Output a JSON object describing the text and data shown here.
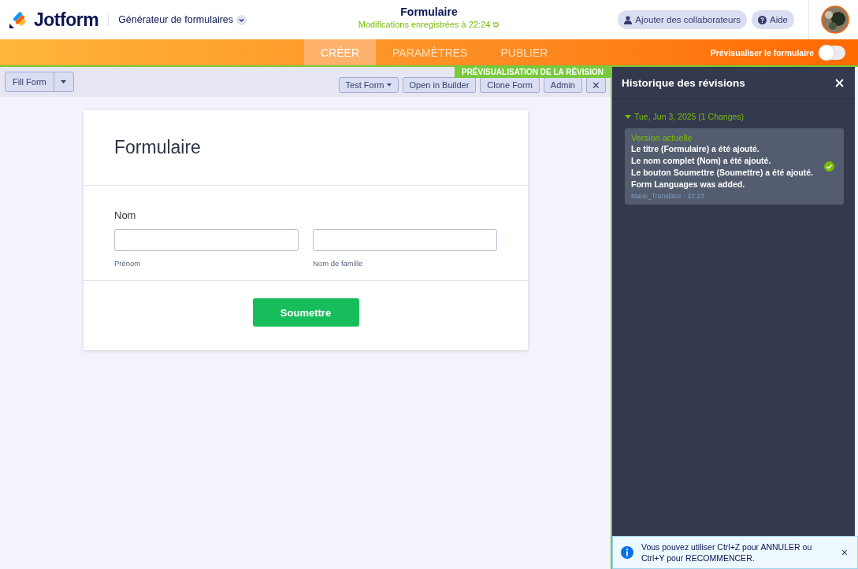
{
  "header": {
    "logo": "Jotform",
    "app_menu": "Générateur de formulaires",
    "title": "Formulaire",
    "saved_status": "Modifications enregistrées à 22:24",
    "buttons": [
      {
        "kind": "collaborators",
        "label": "Ajouter des collaborateurs"
      },
      {
        "kind": "help",
        "label": "Aide"
      }
    ]
  },
  "tabs": [
    {
      "label": "CRÉER",
      "selected": true
    },
    {
      "label": "PARAMÈTRES",
      "selected": false
    },
    {
      "label": "PUBLIER",
      "selected": false
    }
  ],
  "preview_toggle": {
    "label": "Prévisualiser le formulaire",
    "on": false
  },
  "toolbar": {
    "fill_form": "Fill Form",
    "buttons": [
      {
        "label": "Test Form",
        "dropdown": true
      },
      {
        "label": "Open in Builder",
        "dropdown": false
      },
      {
        "label": "Clone Form",
        "dropdown": false
      },
      {
        "label": "Admin",
        "dropdown": false
      }
    ],
    "close": "✕"
  },
  "revision_banner": "PRÉVISUALISATION DE LA RÉVISION",
  "form": {
    "title": "Formulaire",
    "field_label": "Nom",
    "subfields": [
      "Prénom",
      "Nom de famille"
    ],
    "submit": "Soumettre"
  },
  "history": {
    "title": "Historique des révisions",
    "groups": [
      {
        "date": "Tue, Jun 3, 2025 (1 Changes)",
        "expanded": true,
        "revisions": [
          {
            "version": "Version actuelle",
            "changes": [
              "Le titre (Formulaire) a été ajouté.",
              "Le nom complet (Nom) a été ajouté.",
              "Le bouton Soumettre (Soumettre) a été ajouté.",
              "Form Languages was added."
            ],
            "author": "Marie_Translator - 22:23",
            "current": true
          }
        ]
      }
    ]
  },
  "toast": {
    "message": "Vous pouvez utiliser Ctrl+Z pour ANNULER ou Ctrl+Y pour RECOMMENCER.",
    "close": "×"
  }
}
